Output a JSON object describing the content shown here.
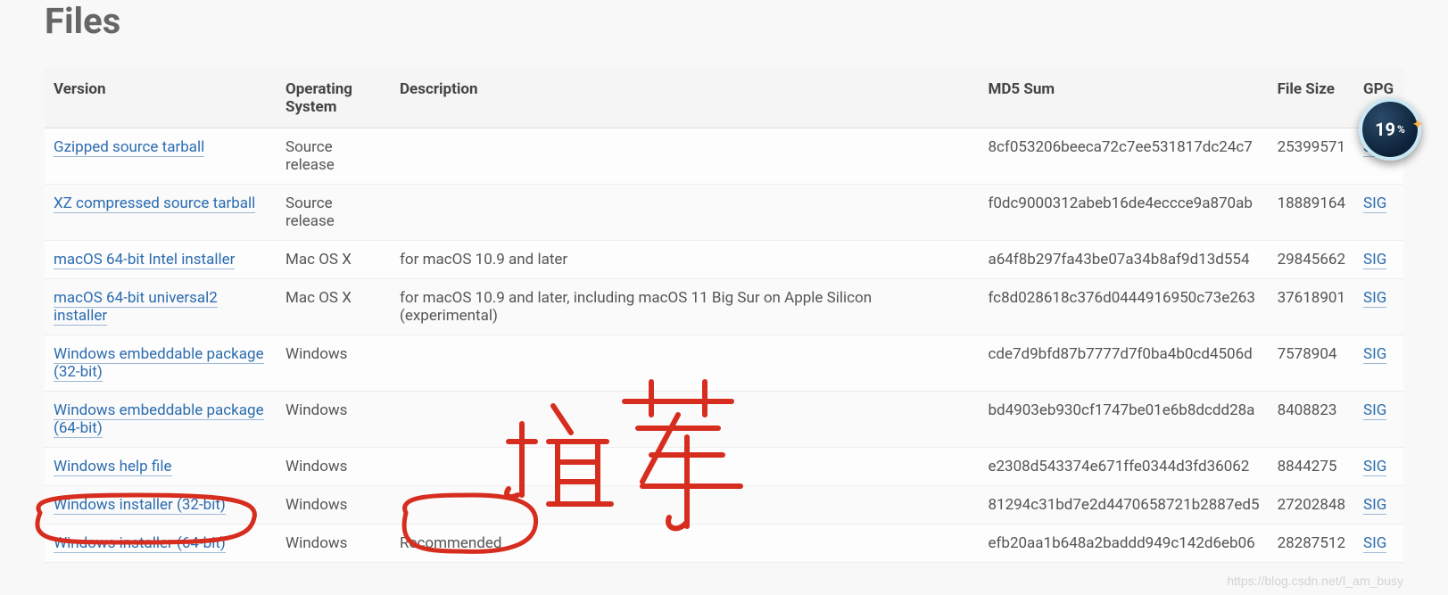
{
  "title": "Files",
  "columns": {
    "version": "Version",
    "os": "Operating System",
    "desc": "Description",
    "md5": "MD5 Sum",
    "size": "File Size",
    "gpg": "GPG"
  },
  "rows": [
    {
      "version": "Gzipped source tarball",
      "os": "Source release",
      "desc": "",
      "md5": "8cf053206beeca72c7ee531817dc24c7",
      "size": "25399571",
      "gpg": "SIG"
    },
    {
      "version": "XZ compressed source tarball",
      "os": "Source release",
      "desc": "",
      "md5": "f0dc9000312abeb16de4eccce9a870ab",
      "size": "18889164",
      "gpg": "SIG"
    },
    {
      "version": "macOS 64-bit Intel installer",
      "os": "Mac OS X",
      "desc": "for macOS 10.9 and later",
      "md5": "a64f8b297fa43be07a34b8af9d13d554",
      "size": "29845662",
      "gpg": "SIG"
    },
    {
      "version": "macOS 64-bit universal2 installer",
      "os": "Mac OS X",
      "desc": "for macOS 10.9 and later, including macOS 11 Big Sur on Apple Silicon (experimental)",
      "md5": "fc8d028618c376d0444916950c73e263",
      "size": "37618901",
      "gpg": "SIG"
    },
    {
      "version": "Windows embeddable package (32-bit)",
      "os": "Windows",
      "desc": "",
      "md5": "cde7d9bfd87b7777d7f0ba4b0cd4506d",
      "size": "7578904",
      "gpg": "SIG"
    },
    {
      "version": "Windows embeddable package (64-bit)",
      "os": "Windows",
      "desc": "",
      "md5": "bd4903eb930cf1747be01e6b8dcdd28a",
      "size": "8408823",
      "gpg": "SIG"
    },
    {
      "version": "Windows help file",
      "os": "Windows",
      "desc": "",
      "md5": "e2308d543374e671ffe0344d3fd36062",
      "size": "8844275",
      "gpg": "SIG"
    },
    {
      "version": "Windows installer (32-bit)",
      "os": "Windows",
      "desc": "",
      "md5": "81294c31bd7e2d4470658721b2887ed5",
      "size": "27202848",
      "gpg": "SIG"
    },
    {
      "version": "Windows installer (64-bit)",
      "os": "Windows",
      "desc": "Recommended",
      "md5": "efb20aa1b648a2baddd949c142d6eb06",
      "size": "28287512",
      "gpg": "SIG"
    }
  ],
  "badge": {
    "value": "19",
    "pct": "%"
  },
  "annotation_text": "推荐",
  "watermark": "https://blog.csdn.net/I_am_busy"
}
